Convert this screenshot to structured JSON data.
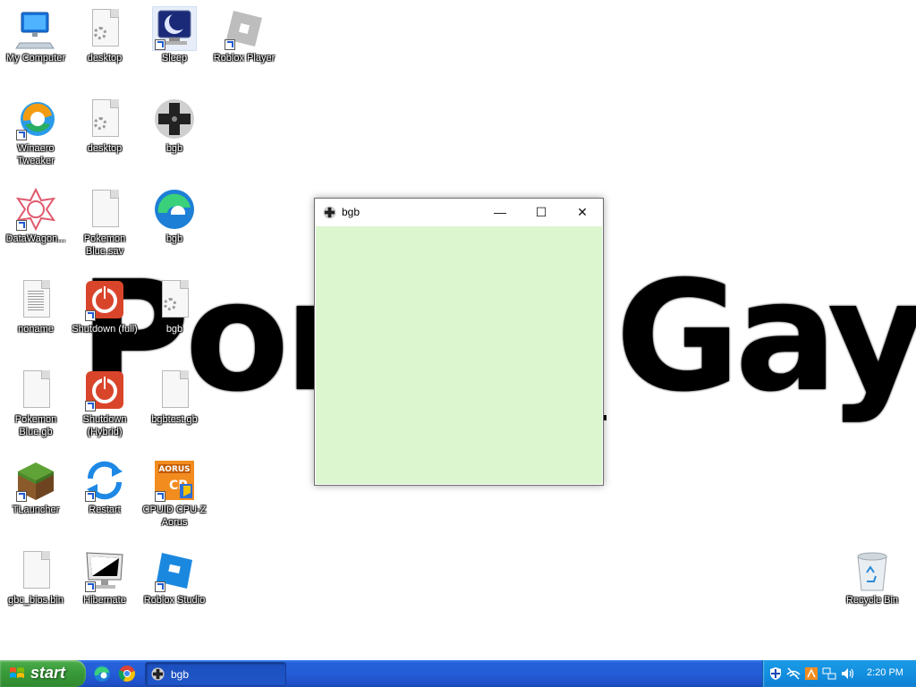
{
  "wallpaper": {
    "text_left": "Pork",
    "text_right": "Gay"
  },
  "desktop_icons": {
    "my_computer": "My Computer",
    "desktop_1": "desktop",
    "sleep": "Sleep",
    "roblox_player": "Roblox Player",
    "winaero": "Winaero Tweaker",
    "desktop_2": "desktop",
    "bgb_1": "bgb",
    "datawagon": "DataWagon...",
    "pokemon_sav": "Pokemon Blue.sav",
    "edge": "bgb",
    "noname": "noname",
    "shutdown_full": "Shutdown (full)",
    "bgb_2": "bgb",
    "pokemon_gb": "Pokemon Blue.gb",
    "shutdown_hybrid": "Shutdown (Hybrid)",
    "bgbtest": "bgbtest.gb",
    "tlauncher": "TLauncher",
    "restart": "Restart",
    "cpuz": "CPUID CPU-Z Aorus",
    "gbc_bios": "gbc_bios.bin",
    "hibernate": "Hibernate",
    "roblox_studio": "Roblox Studio",
    "recycle_bin": "Recycle Bin"
  },
  "window": {
    "title": "bgb",
    "minimize": "—",
    "maximize": "☐",
    "close": "✕",
    "client_color": "#dcf6cf"
  },
  "taskbar": {
    "start_label": "start",
    "task_label": "bgb",
    "clock": "2:20 PM"
  }
}
